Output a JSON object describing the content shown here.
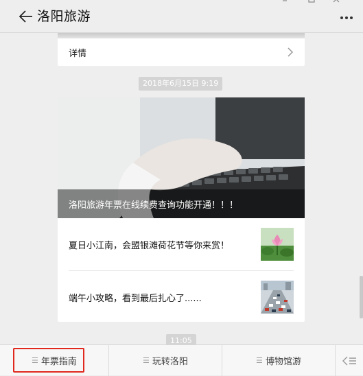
{
  "header": {
    "title": "洛阳旅游",
    "back_icon": "arrow-left-icon",
    "more_icon": "more-dots-icon"
  },
  "top_card": {
    "detail_label": "详情"
  },
  "timestamps": {
    "first": "2018年6月15日 9:19",
    "second": "11:05"
  },
  "news": {
    "cover_caption": "洛阳旅游年票在线续费查询功能开通！！！",
    "items": [
      {
        "title": "夏日小江南，会盟银滩荷花节等你来赏！",
        "thumb": "lotus-flower-thumbnail"
      },
      {
        "title": "端午小攻略，看到最后扎心了......",
        "thumb": "traffic-jam-thumbnail"
      }
    ]
  },
  "menu": {
    "items": [
      {
        "label": "年票指南"
      },
      {
        "label": "玩转洛阳"
      },
      {
        "label": "博物馆游"
      }
    ],
    "keyboard_icon": "keyboard-toggle-icon"
  },
  "colors": {
    "highlight": "#e0281e",
    "background": "#eeeeee"
  }
}
